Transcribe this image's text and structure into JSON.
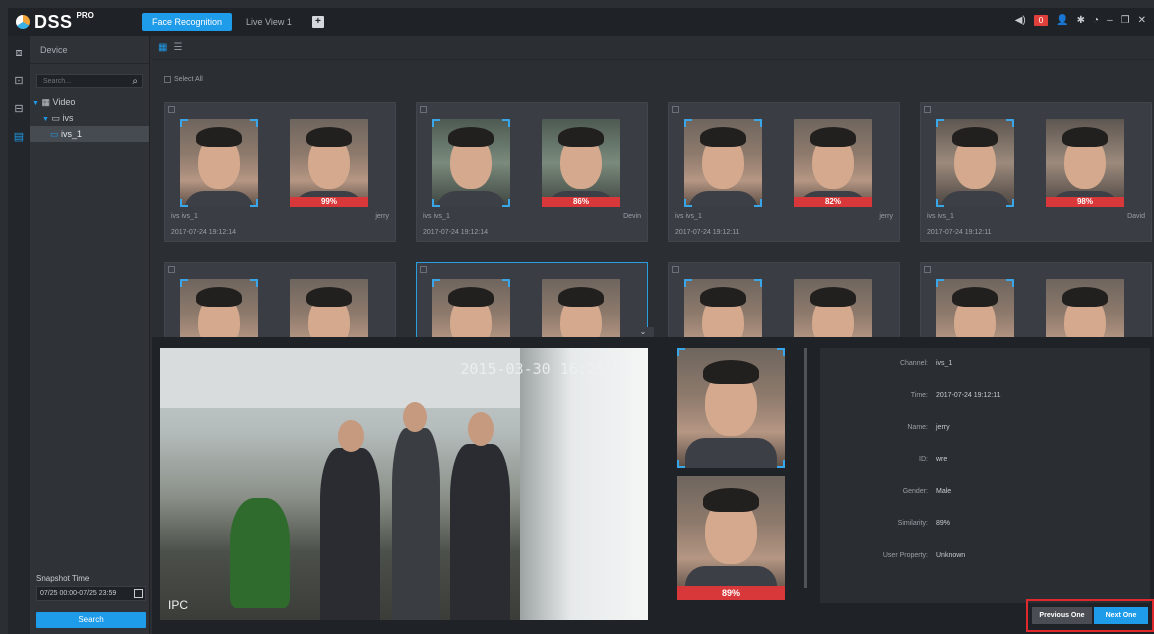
{
  "app": {
    "name": "DSS",
    "edition": "PRO"
  },
  "tabs": [
    {
      "label": "Face Recognition"
    },
    {
      "label": "Live View 1"
    }
  ],
  "header": {
    "alarm_count": "0"
  },
  "device_panel": {
    "title": "Device",
    "search_placeholder": "Search...",
    "tree": {
      "video": "Video",
      "device": "ivs",
      "channel": "ivs_1"
    },
    "snapshot_time_label": "Snapshot Time",
    "snapshot_time_value": "07/25 00:00-07/25 23:59",
    "search_button": "Search"
  },
  "gallery": {
    "select_all": "Select All",
    "cards": [
      {
        "channel": "ivs  ivs_1",
        "name": "jerry",
        "similarity": "99%",
        "time": "2017-07-24 19:12:14"
      },
      {
        "channel": "ivs  ivs_1",
        "name": "Devin",
        "similarity": "86%",
        "time": "2017-07-24 19:12:14"
      },
      {
        "channel": "ivs  ivs_1",
        "name": "jerry",
        "similarity": "82%",
        "time": "2017-07-24 19:12:11"
      },
      {
        "channel": "ivs  ivs_1",
        "name": "David",
        "similarity": "98%",
        "time": "2017-07-24 19:12:11"
      }
    ]
  },
  "detail": {
    "video_osd": "2015-03-30 16:25:12",
    "video_label": "IPC",
    "similarity_badge": "89%",
    "fields": [
      {
        "key": "Channel:",
        "value": "ivs_1"
      },
      {
        "key": "Time:",
        "value": "2017-07-24 19:12:11"
      },
      {
        "key": "Name:",
        "value": "jerry"
      },
      {
        "key": "ID:",
        "value": "wre"
      },
      {
        "key": "Gender:",
        "value": "Male"
      },
      {
        "key": "Similarity:",
        "value": "89%"
      },
      {
        "key": "User Property:",
        "value": "Unknown"
      }
    ],
    "previous_button": "Previous One",
    "next_button": "Next One"
  }
}
